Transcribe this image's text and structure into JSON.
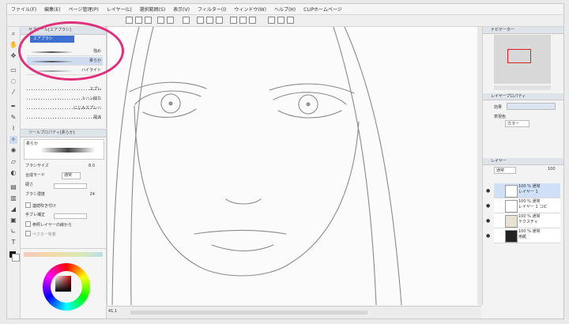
{
  "menu": [
    "ファイル(F)",
    "編集(E)",
    "ページ管理(P)",
    "レイヤー(L)",
    "選択範囲(S)",
    "表示(V)",
    "フィルター(I)",
    "ウィンドウ(W)",
    "ヘルプ(H)",
    "CLIPホームページ"
  ],
  "subtool": {
    "title": "サブツール[エアブラシ]",
    "tab": "エアブラシ",
    "presets": [
      "強め",
      "柔らか",
      "ハイライト"
    ],
    "sprays": [
      "スプレ",
      "トーン削り",
      "にじみスプレー",
      "飛沫"
    ]
  },
  "toolprop": {
    "title": "ツールプロパティ[柔らか]",
    "preview_label": "柔らか",
    "brush_size_label": "ブラシサイズ",
    "brush_size_value": "8.0",
    "blend_mode_label": "合成モード",
    "blend_mode_value": "通常",
    "hardness_label": "硬さ",
    "density_label": "ブラシ濃度",
    "density_value": "24",
    "cont_spray_label": "連続吹き付け",
    "stabilize_label": "手ブレ補正",
    "ref_layer_label": "参照レイヤーの線から",
    "vector_label": "ベクター吸着"
  },
  "navigator": {
    "title": "ナビゲーター"
  },
  "layer_property": {
    "title": "レイヤープロパティ",
    "effect_label": "効果",
    "expression_label": "表現色",
    "expression_value": "カラー"
  },
  "layers": {
    "title": "レイヤー",
    "blend": "通常",
    "opacity": "100",
    "items": [
      {
        "line1": "100 % 通常",
        "line2": "レイヤー 1"
      },
      {
        "line1": "100 % 通常",
        "line2": "レイヤー 1 コピ"
      },
      {
        "line1": "100 % 通常",
        "line2": "テクスチャ"
      },
      {
        "line1": "100 % 通常",
        "line2": "用紙"
      }
    ]
  },
  "status": {
    "zoom": "41.1"
  }
}
